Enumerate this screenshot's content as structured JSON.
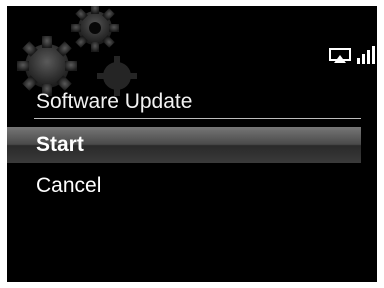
{
  "title": "Software Update",
  "menu": {
    "items": [
      {
        "label": "Start",
        "selected": true
      },
      {
        "label": "Cancel",
        "selected": false
      }
    ]
  },
  "status": {
    "icons": [
      "airplay-icon",
      "signal-strength-icon"
    ]
  },
  "colors": {
    "background": "#000000",
    "selection_highlight": "#5a5a5a",
    "text": "#ffffff"
  }
}
